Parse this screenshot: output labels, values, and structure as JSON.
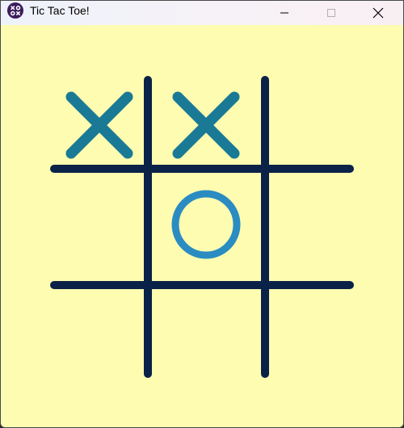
{
  "window": {
    "title": "Tic Tac Toe!",
    "app_icon": "tic-tac-toe-app-icon",
    "controls": [
      "minimize-icon",
      "maximize-icon",
      "close-icon"
    ]
  },
  "colors": {
    "background": "#fdfcb0",
    "grid_line": "#0a2248",
    "x_mark": "#1a7a96",
    "o_mark": "#2b8cc2"
  },
  "board": {
    "rows": 3,
    "cols": 3,
    "cells": [
      "X",
      "X",
      "",
      "",
      "O",
      "",
      "",
      "",
      ""
    ]
  }
}
